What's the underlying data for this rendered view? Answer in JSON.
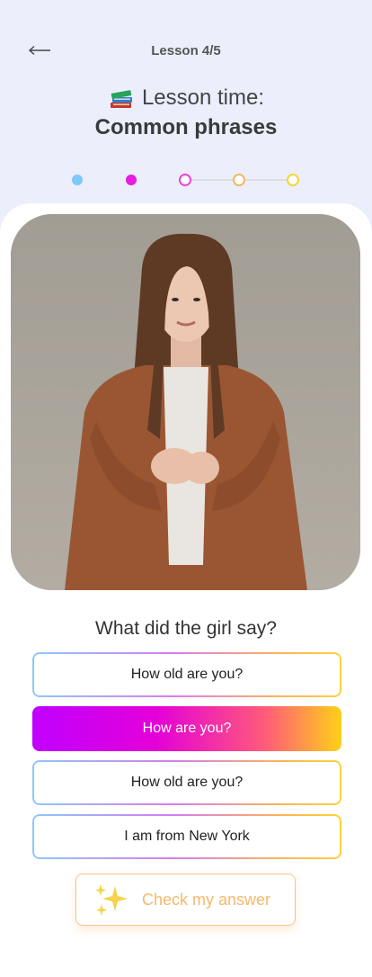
{
  "header": {
    "lesson_counter": "Lesson 4/5",
    "title_prefix": "Lesson time:",
    "title": "Common phrases",
    "back_icon": "arrow-left-icon",
    "title_icon": "books-icon"
  },
  "progress": {
    "total_steps": 5,
    "completed_steps": 2,
    "current_step": 2
  },
  "question": "What did the girl say?",
  "options": [
    {
      "label": "How old are you?",
      "selected": false
    },
    {
      "label": "How are you?",
      "selected": true
    },
    {
      "label": "How old are you?",
      "selected": false
    },
    {
      "label": "I am from New York",
      "selected": false
    }
  ],
  "check_button": {
    "label": "Check my answer",
    "icon": "sparkle-icon"
  },
  "colors": {
    "background": "#eceefc",
    "accent_blue": "#7ec8f7",
    "accent_magenta": "#e41de0",
    "accent_orange": "#f2b85a",
    "accent_yellow": "#f3d733",
    "check_text": "#f5b96b"
  }
}
